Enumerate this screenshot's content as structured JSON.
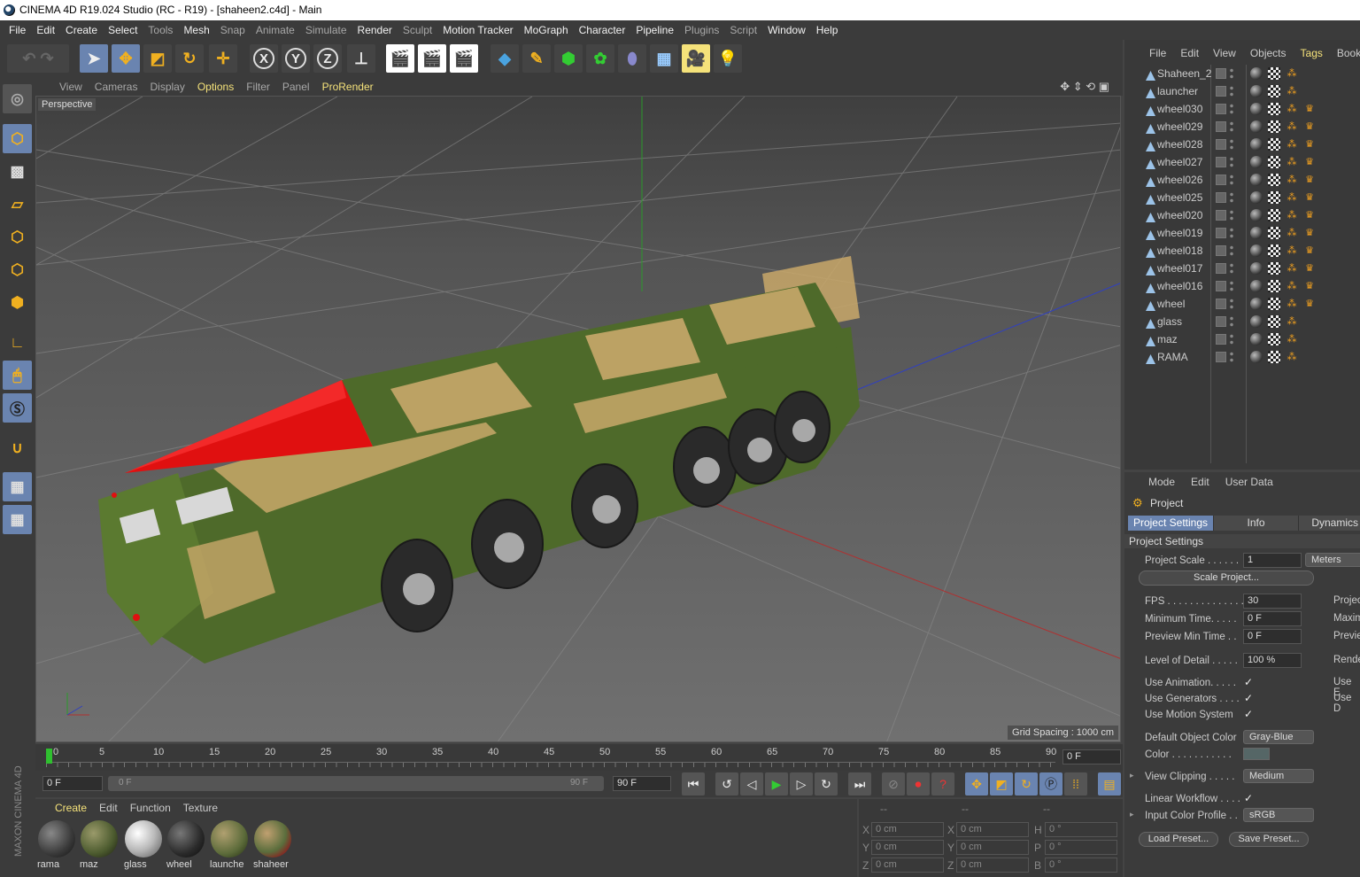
{
  "window": {
    "title": "CINEMA 4D R19.024 Studio (RC - R19) - [shaheen2.c4d] - Main"
  },
  "menu": {
    "items": [
      "File",
      "Edit",
      "Create",
      "Select",
      "Tools",
      "Mesh",
      "Snap",
      "Animate",
      "Simulate",
      "Render",
      "Sculpt",
      "Motion Tracker",
      "MoGraph",
      "Character",
      "Pipeline",
      "Plugins",
      "Script",
      "Window",
      "Help"
    ]
  },
  "toolbar": {
    "x_label": "X",
    "y_label": "Y",
    "z_label": "Z"
  },
  "viewport": {
    "menu": [
      "View",
      "Cameras",
      "Display",
      "Options",
      "Filter",
      "Panel",
      "ProRender"
    ],
    "camera_label": "Perspective",
    "grid_spacing": "Grid Spacing : 1000 cm"
  },
  "timeline": {
    "ticks": [
      "0",
      "5",
      "10",
      "15",
      "20",
      "25",
      "30",
      "35",
      "40",
      "45",
      "50",
      "55",
      "60",
      "65",
      "70",
      "75",
      "80",
      "85",
      "90"
    ],
    "current_frame": "0 F",
    "start_frame": "0 F",
    "range_start": "0 F",
    "range_end": "90 F",
    "end_frame": "90 F"
  },
  "materials": {
    "menu": [
      "Create",
      "Edit",
      "Function",
      "Texture"
    ],
    "items": [
      {
        "name": "rama",
        "color": "#3a3a3a"
      },
      {
        "name": "maz",
        "color": "#4b5a2e"
      },
      {
        "name": "glass",
        "color": "#b8b8b8"
      },
      {
        "name": "wheel",
        "color": "#2a2a2a"
      },
      {
        "name": "launche",
        "color": "#5c6b3a"
      },
      {
        "name": "shaheer",
        "color": "#5a6d3c"
      }
    ],
    "brand": "MAXON CINEMA 4D"
  },
  "coordinates": {
    "header": [
      "--",
      "--",
      "--"
    ],
    "rows": [
      {
        "l1": "X",
        "v1": "0 cm",
        "l2": "X",
        "v2": "0 cm",
        "l3": "H",
        "v3": "0 °"
      },
      {
        "l1": "Y",
        "v1": "0 cm",
        "l2": "Y",
        "v2": "0 cm",
        "l3": "P",
        "v3": "0 °"
      },
      {
        "l1": "Z",
        "v1": "0 cm",
        "l2": "Z",
        "v2": "0 cm",
        "l3": "B",
        "v3": "0 °"
      }
    ]
  },
  "objects": {
    "menu": [
      "File",
      "Edit",
      "View",
      "Objects",
      "Tags",
      "Bookmarks"
    ],
    "items": [
      "Shaheen_2",
      "launcher",
      "wheel030",
      "wheel029",
      "wheel028",
      "wheel027",
      "wheel026",
      "wheel025",
      "wheel020",
      "wheel019",
      "wheel018",
      "wheel017",
      "wheel016",
      "wheel",
      "glass",
      "maz",
      "RAMA"
    ]
  },
  "attributes": {
    "menu": [
      "Mode",
      "Edit",
      "User Data"
    ],
    "object": "Project",
    "tabs": [
      "Project Settings",
      "Info",
      "Dynamics"
    ],
    "section": "Project Settings",
    "project_scale_label": "Project Scale . . . . . .",
    "project_scale_value": "1",
    "project_scale_unit": "Meters",
    "scale_button": "Scale Project...",
    "fps_label": "FPS . . . . . . . . . . . . . .",
    "fps_value": "30",
    "min_time_label": "Minimum Time. . . . .",
    "min_time_value": "0 F",
    "preview_min_label": "Preview Min Time . .",
    "preview_min_value": "0 F",
    "right_col": [
      "Projec",
      "Maxim",
      "Previe"
    ],
    "lod_label": "Level of Detail . . . . .",
    "lod_value": "100 %",
    "lod_right": "Rende",
    "use_animation": "Use Animation. . . . .",
    "use_generators": "Use Generators . . . .",
    "use_motion": "Use Motion System",
    "use_right": [
      "Use E",
      "Use D"
    ],
    "default_color_label": "Default Object Color",
    "default_color_value": "Gray-Blue",
    "color_label": "Color . . . . . . . . . . .",
    "view_clipping_label": "View Clipping . . . . .",
    "view_clipping_value": "Medium",
    "linear_workflow": "Linear Workflow . . . .",
    "input_color_label": "Input Color Profile . .",
    "input_color_value": "sRGB",
    "load_preset": "Load Preset...",
    "save_preset": "Save Preset..."
  },
  "colors": {
    "accent_blue": "#6a84b0",
    "highlight_yellow": "#f5e27a",
    "missile_red": "#e01010"
  }
}
